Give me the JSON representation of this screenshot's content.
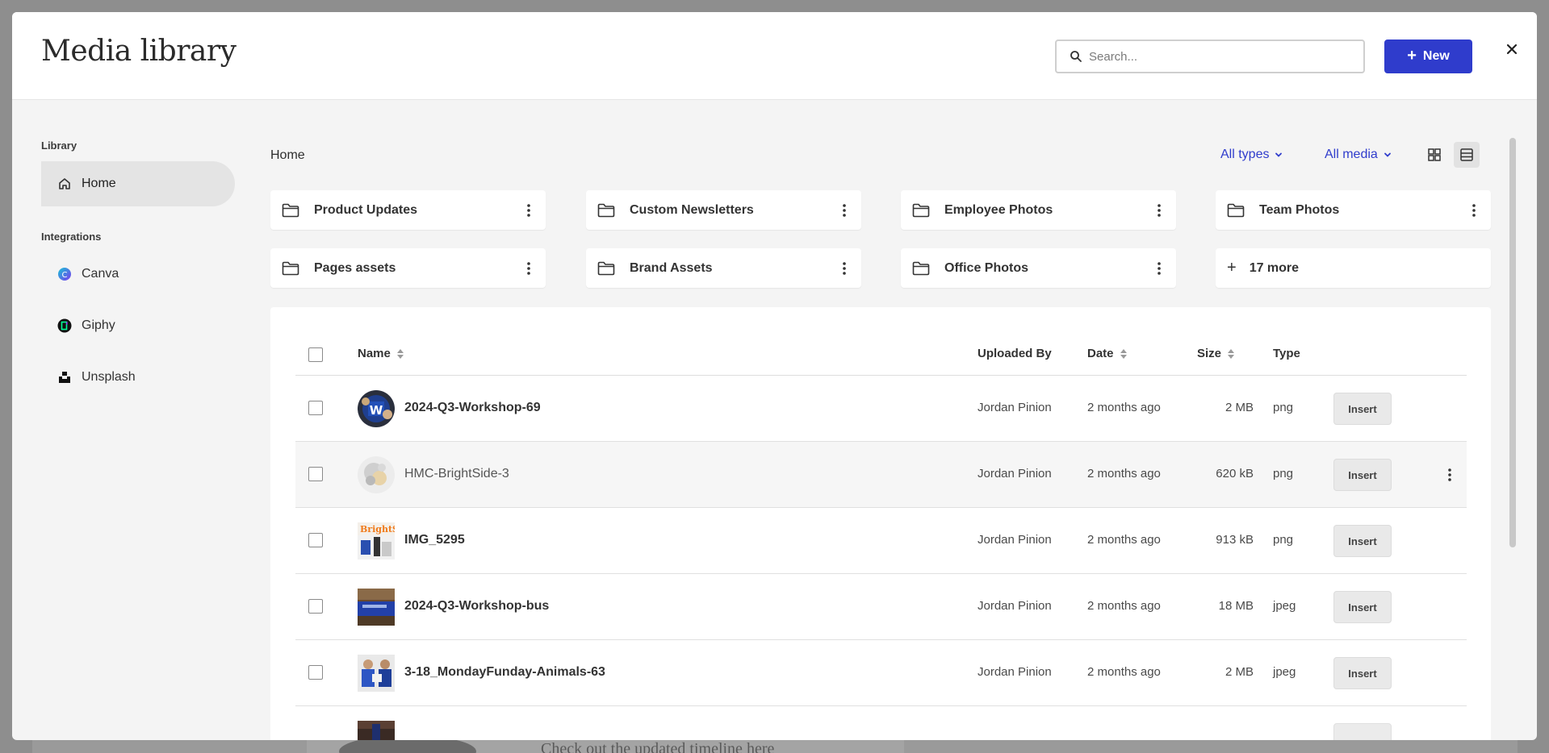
{
  "modal": {
    "title": "Media library",
    "search": {
      "placeholder": "Search...",
      "value": ""
    },
    "new_button": {
      "icon": "plus-icon",
      "label": "New"
    },
    "close_icon": "close-icon"
  },
  "sidebar": {
    "library_heading": "Library",
    "library_items": [
      {
        "icon": "home-icon",
        "label": "Home",
        "active": true
      }
    ],
    "integrations_heading": "Integrations",
    "integrations": [
      {
        "icon": "canva-icon",
        "label": "Canva"
      },
      {
        "icon": "giphy-icon",
        "label": "Giphy"
      },
      {
        "icon": "unsplash-icon",
        "label": "Unsplash"
      }
    ]
  },
  "main": {
    "breadcrumb": "Home",
    "filters": [
      {
        "label": "All types",
        "icon": "chevron-down-icon"
      },
      {
        "label": "All media",
        "icon": "chevron-down-icon"
      }
    ],
    "view_modes": [
      {
        "icon": "grid-view-icon",
        "active": false
      },
      {
        "icon": "list-view-icon",
        "active": true
      }
    ],
    "folders": [
      {
        "name": "Product Updates"
      },
      {
        "name": "Custom Newsletters"
      },
      {
        "name": "Employee Photos"
      },
      {
        "name": "Team Photos"
      },
      {
        "name": "Pages assets"
      },
      {
        "name": "Brand Assets"
      },
      {
        "name": "Office Photos"
      }
    ],
    "more_folders": {
      "icon": "plus-icon",
      "label": "17 more"
    },
    "table": {
      "columns": [
        "Name",
        "Uploaded By",
        "Date",
        "Size",
        "Type"
      ],
      "insert_label": "Insert",
      "rows": [
        {
          "name": "2024-Q3-Workshop-69",
          "uploaded_by": "Jordan Pinion",
          "date": "2 months ago",
          "size": "2 MB",
          "type": "png"
        },
        {
          "name": "HMC-BrightSide-3",
          "uploaded_by": "Jordan Pinion",
          "date": "2 months ago",
          "size": "620 kB",
          "type": "png"
        },
        {
          "name": "IMG_5295",
          "uploaded_by": "Jordan Pinion",
          "date": "2 months ago",
          "size": "913 kB",
          "type": "png"
        },
        {
          "name": "2024-Q3-Workshop-bus",
          "uploaded_by": "Jordan Pinion",
          "date": "2 months ago",
          "size": "18 MB",
          "type": "jpeg"
        },
        {
          "name": "3-18_MondayFunday-Animals-63",
          "uploaded_by": "Jordan Pinion",
          "date": "2 months ago",
          "size": "2 MB",
          "type": "jpeg"
        }
      ]
    }
  },
  "backdrop": {
    "text": "Check out the updated timeline ",
    "link": "here"
  },
  "colors": {
    "accent": "#2f3ccc",
    "overlay": "#8e8e8e",
    "modal_bg": "#f4f4f4"
  }
}
